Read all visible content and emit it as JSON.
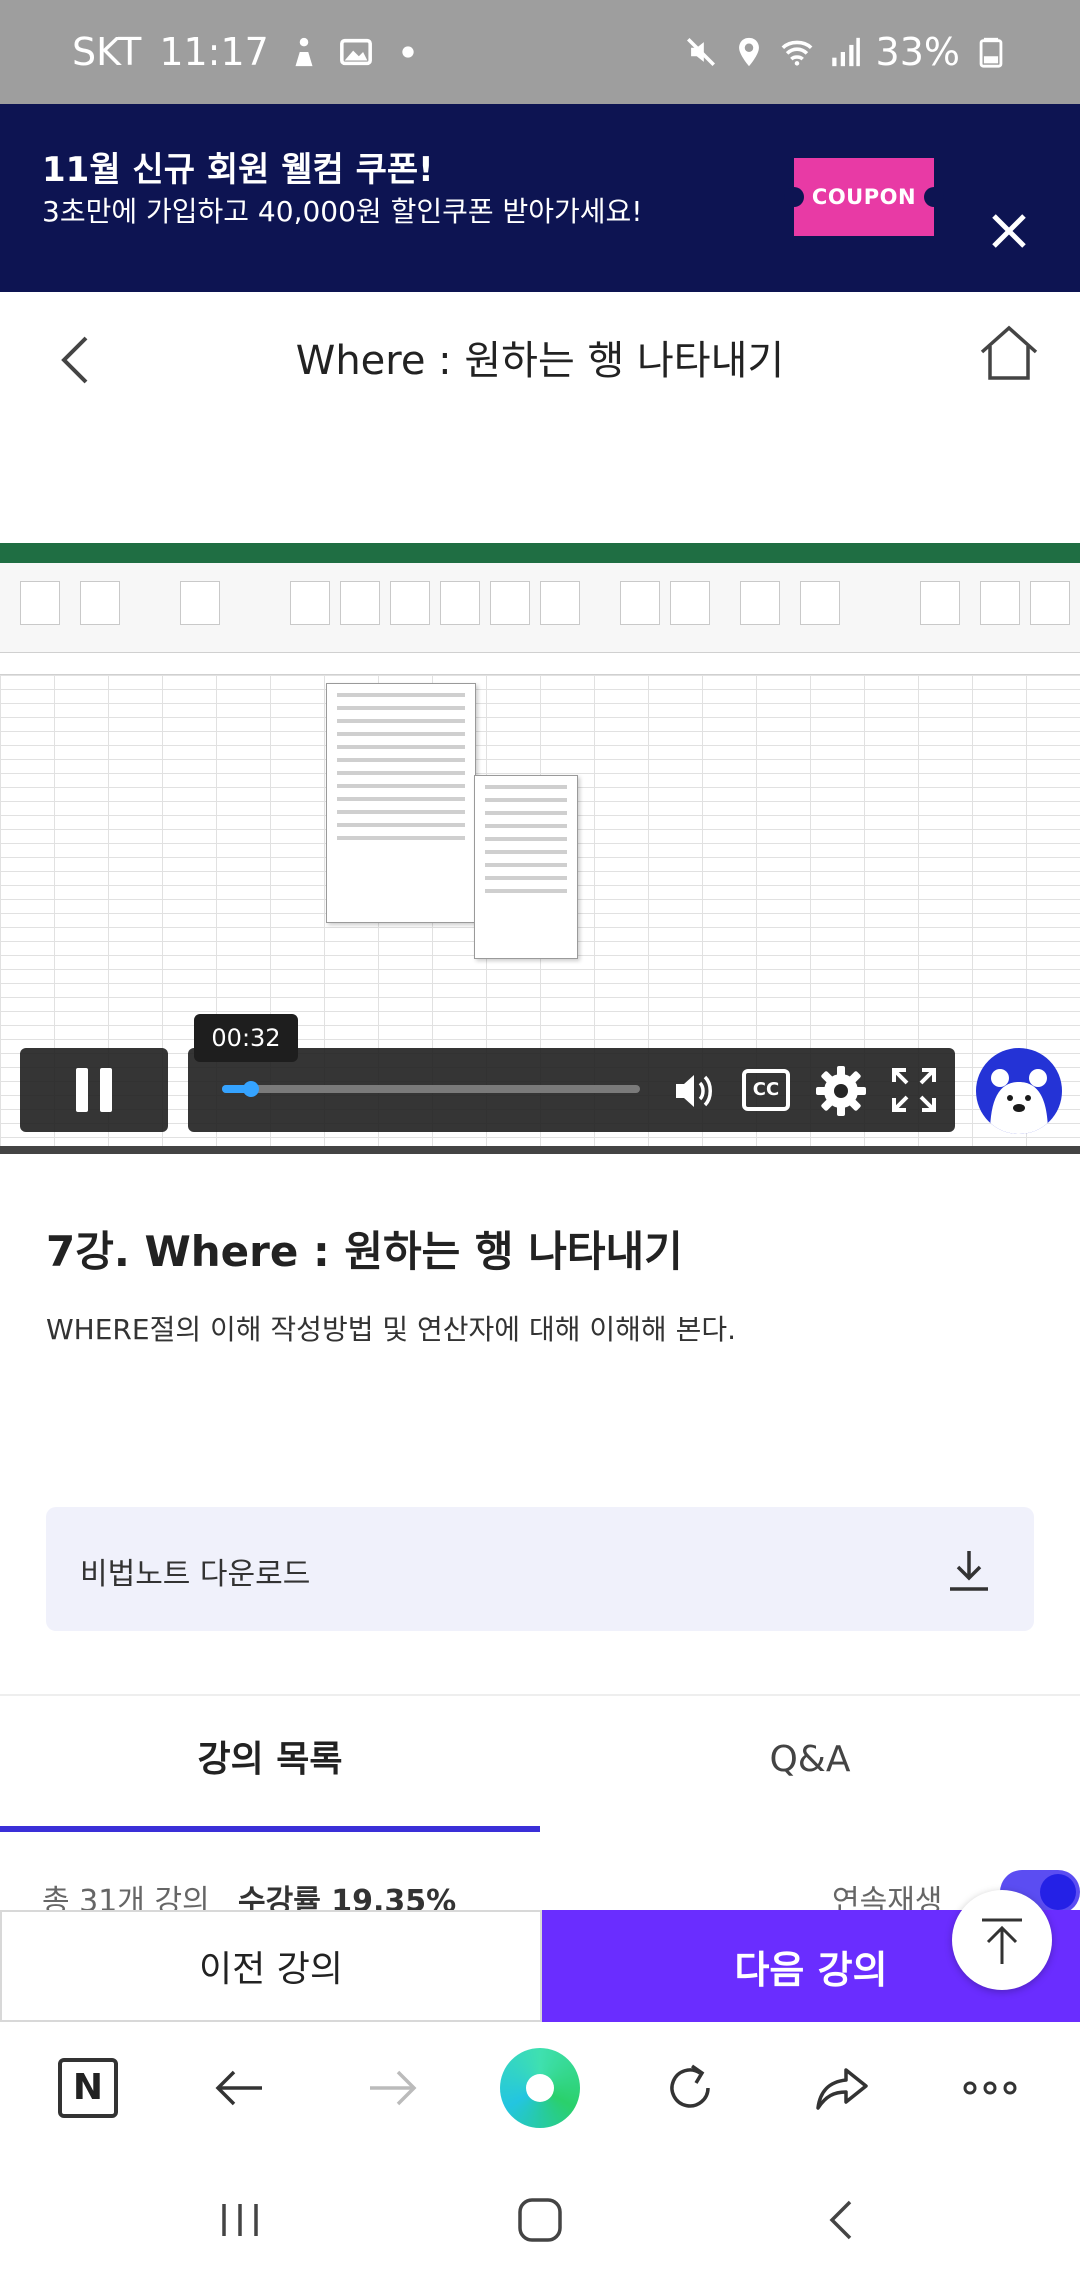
{
  "status_bar": {
    "carrier": "SKT",
    "time": "11:17",
    "battery": "33%",
    "icons": [
      "person-icon",
      "image-icon",
      "dot-icon",
      "mute-icon",
      "location-icon",
      "wifi-icon",
      "signal-icon",
      "battery-icon"
    ]
  },
  "promo": {
    "title": "11월 신규 회원 웰컴 쿠폰!",
    "subtitle": "3초만에 가입하고 40,000원 할인쿠폰 받아가세요!",
    "coupon_label": "COUPON",
    "bg_color": "#0d1452",
    "coupon_color": "#e83aa5"
  },
  "header": {
    "title": "Where : 원하는 행 나타내기"
  },
  "video": {
    "current_time": "00:32",
    "progress": 0.07,
    "cc_label": "CC"
  },
  "lecture": {
    "title": "7강. Where : 원하는 행 나타내기",
    "description": "WHERE절의 이해 작성방법 및 연산자에 대해 이해해 본다."
  },
  "download": {
    "label": "비법노트 다운로드"
  },
  "tabs": [
    {
      "label": "강의 목록",
      "active": true
    },
    {
      "label": "Q&A",
      "active": false
    }
  ],
  "list_info": {
    "total": "총 31개 강의",
    "rate": "수강률 19.35%",
    "continuous": "연속재생"
  },
  "buttons": {
    "prev": "이전 강의",
    "next": "다음 강의"
  },
  "browser_bar": {
    "n_label": "N"
  },
  "colors": {
    "accent": "#6a2dff",
    "tab_underline": "#3a2fd8",
    "progress": "#35a3ff"
  }
}
